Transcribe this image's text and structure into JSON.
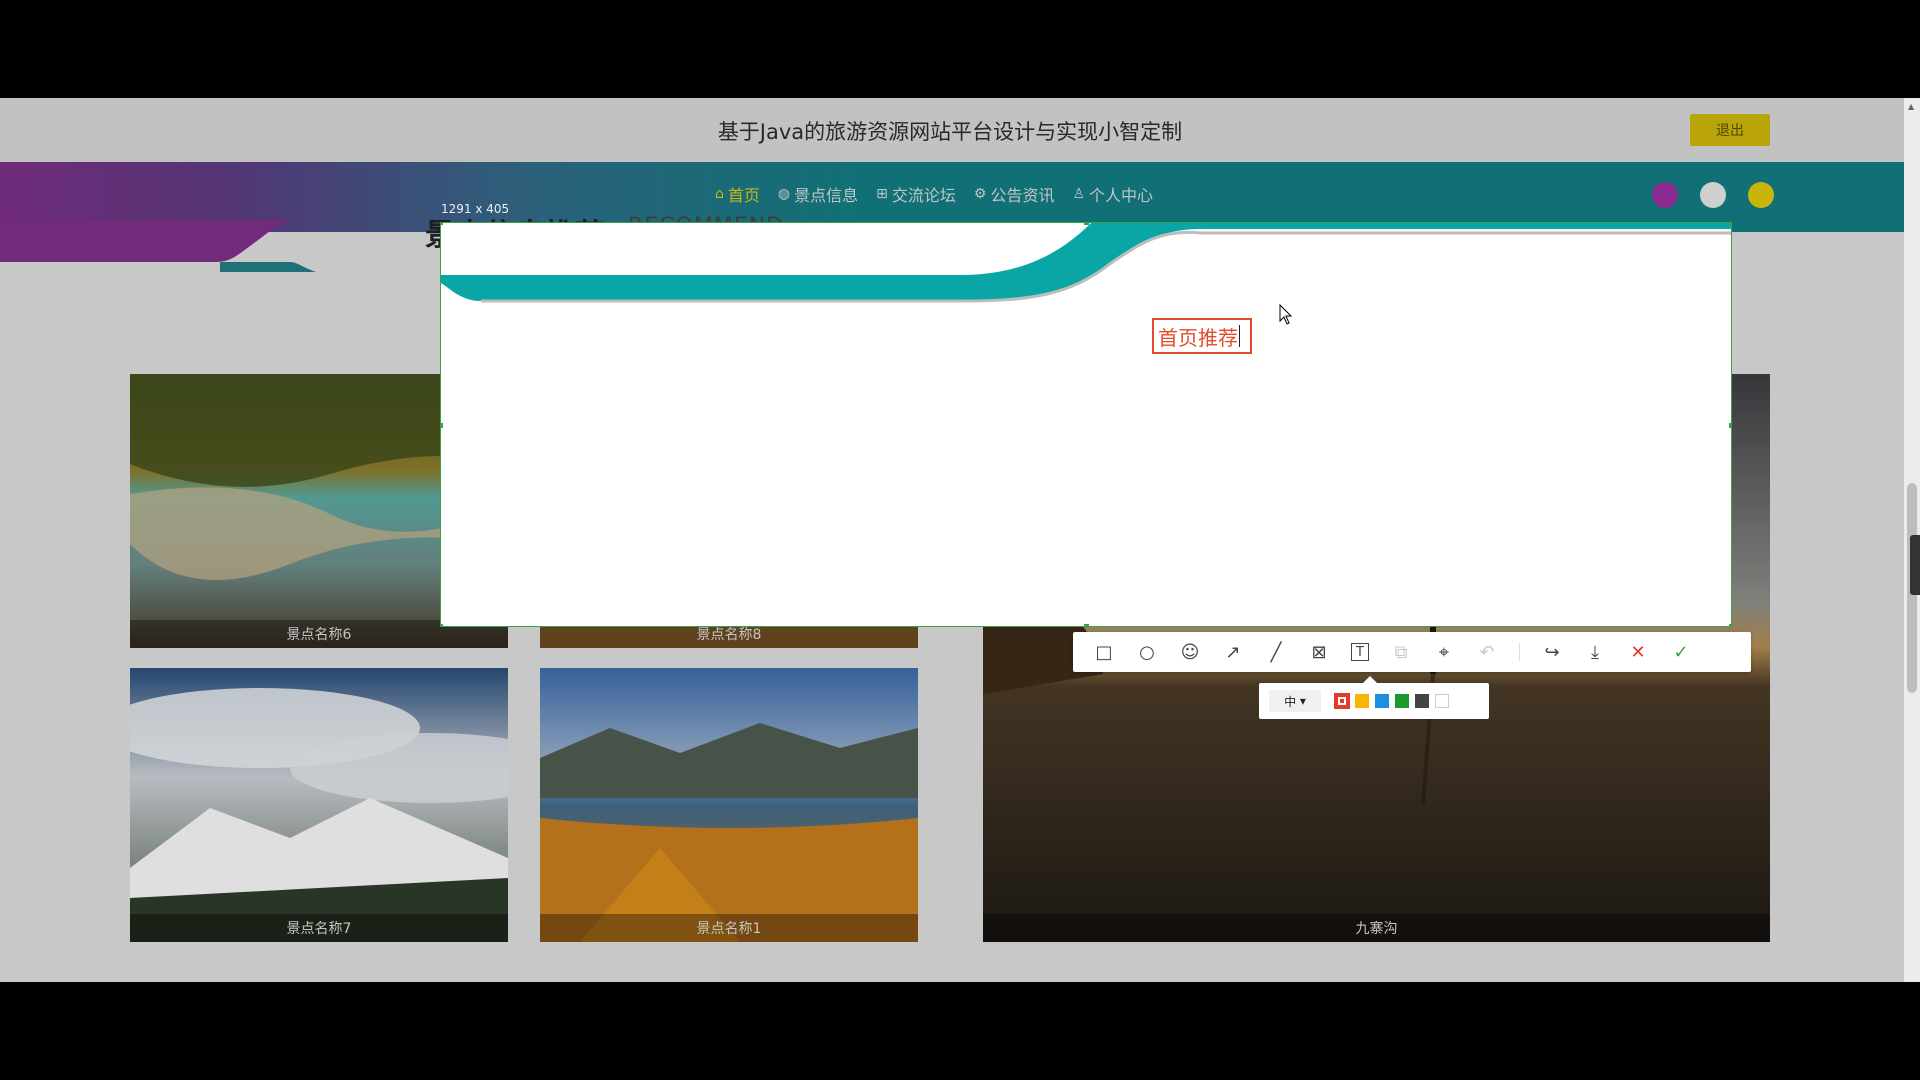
{
  "header": {
    "title": "基于Java的旅游资源网站平台设计与实现小智定制",
    "logout_label": "退出"
  },
  "nav": {
    "items": [
      {
        "label": "首页",
        "icon": "home-icon",
        "active": true
      },
      {
        "label": "景点信息",
        "icon": "globe-icon",
        "active": false
      },
      {
        "label": "交流论坛",
        "icon": "gift-icon",
        "active": false
      },
      {
        "label": "公告资讯",
        "icon": "gear-icon",
        "active": false
      },
      {
        "label": "个人中心",
        "icon": "user-icon",
        "active": false
      }
    ],
    "theme_dots": [
      "#8a2c8f",
      "#cfcfcf",
      "#c9b40a"
    ]
  },
  "section": {
    "title": "景点信息推荐",
    "subtitle": "RECOMMEND"
  },
  "tiles": [
    {
      "caption": "景点名称6",
      "scene": "autumn-lake"
    },
    {
      "caption": "景点名称8",
      "scene": "river-canyon"
    },
    {
      "caption": "景点名称7",
      "scene": "snow-mountain"
    },
    {
      "caption": "景点名称1",
      "scene": "mountain-lake-autumn"
    },
    {
      "caption": "九寨沟",
      "scene": "lone-tree-sunset"
    }
  ],
  "screenshot_tool": {
    "selection_size": "1291 x 405",
    "text_annotation": "首页推荐",
    "toolbar": [
      {
        "name": "rectangle-tool-icon",
        "glyph": "□",
        "enabled": true
      },
      {
        "name": "ellipse-tool-icon",
        "glyph": "○",
        "enabled": true
      },
      {
        "name": "emoji-tool-icon",
        "glyph": "☺",
        "enabled": true
      },
      {
        "name": "arrow-tool-icon",
        "glyph": "↗",
        "enabled": true
      },
      {
        "name": "line-tool-icon",
        "glyph": "╱",
        "enabled": true
      },
      {
        "name": "mosaic-tool-icon",
        "glyph": "⊠",
        "enabled": true
      },
      {
        "name": "text-tool-icon",
        "glyph": "T",
        "enabled": true
      },
      {
        "name": "copy-tool-icon",
        "glyph": "⧉",
        "enabled": false
      },
      {
        "name": "ocr-tool-icon",
        "glyph": "⌖",
        "enabled": true
      },
      {
        "name": "undo-tool-icon",
        "glyph": "↶",
        "enabled": false
      },
      {
        "name": "share-tool-icon",
        "glyph": "↪",
        "enabled": true
      },
      {
        "name": "save-tool-icon",
        "glyph": "⤓",
        "enabled": true
      },
      {
        "name": "cancel-icon",
        "glyph": "✕",
        "enabled": true
      },
      {
        "name": "confirm-icon",
        "glyph": "✓",
        "enabled": true
      }
    ],
    "font_size_option": "中",
    "colors": [
      "#e23b2c",
      "#f5b700",
      "#1e8fe0",
      "#1a9a2a",
      "#444444",
      "#ffffff"
    ],
    "selected_color": "#e23b2c"
  }
}
